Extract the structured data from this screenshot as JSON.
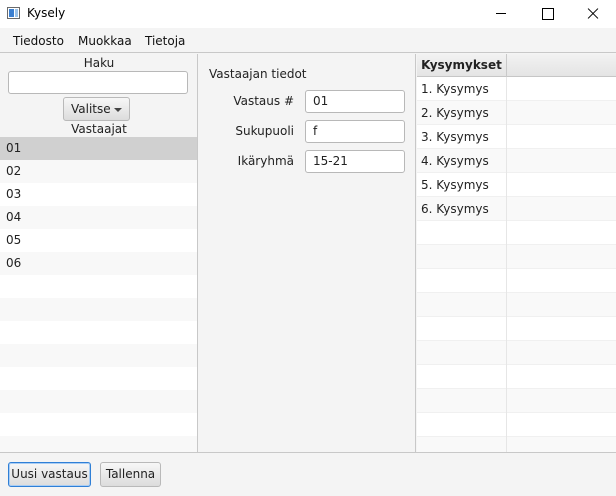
{
  "window": {
    "title": "Kysely"
  },
  "menu": [
    "Tiedosto",
    "Muokkaa",
    "Tietoja"
  ],
  "left": {
    "search_label": "Haku",
    "search_value": "",
    "select_label": "Valitse",
    "respondents_label": "Vastaajat",
    "respondents": [
      "01",
      "02",
      "03",
      "04",
      "05",
      "06",
      "",
      "",
      "",
      "",
      "",
      "",
      "",
      ""
    ],
    "selected_index": 0
  },
  "center": {
    "title": "Vastaajan tiedot",
    "fields": [
      {
        "label": "Vastaus #",
        "value": "01"
      },
      {
        "label": "Sukupuoli",
        "value": "f"
      },
      {
        "label": "Ikäryhmä",
        "value": "15-21"
      }
    ]
  },
  "questions": {
    "columns": [
      "Kysymykset",
      ""
    ],
    "rows": [
      "1. Kysymys",
      "2. Kysymys",
      "3. Kysymys",
      "4. Kysymys",
      "5. Kysymys",
      "6. Kysymys",
      "",
      "",
      "",
      "",
      "",
      "",
      "",
      "",
      "",
      ""
    ]
  },
  "buttons": {
    "new": "Uusi vastaus",
    "save": "Tallenna"
  }
}
